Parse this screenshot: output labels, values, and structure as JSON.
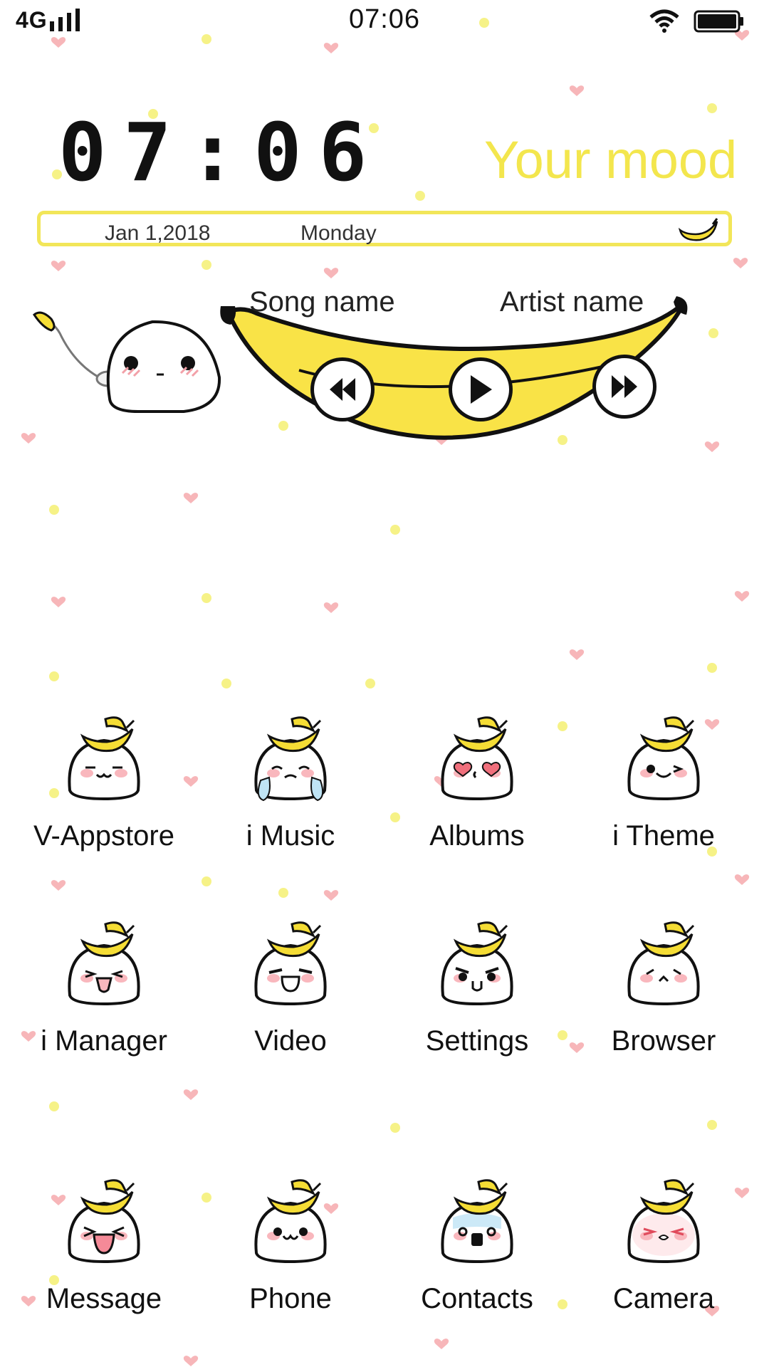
{
  "status_bar": {
    "network": "4G",
    "time": "07:06",
    "icons": [
      "signal-icon",
      "wifi-icon",
      "battery-icon"
    ]
  },
  "widget": {
    "clock": "07:06",
    "mood_text": "Your mood",
    "date": "Jan 1,2018",
    "weekday": "Monday"
  },
  "music": {
    "song_name": "Song name",
    "artist_name": "Artist name",
    "controls": [
      "previous-icon",
      "play-icon",
      "next-icon"
    ]
  },
  "apps": [
    {
      "label": "V-Appstore",
      "face": "smile"
    },
    {
      "label": "i Music",
      "face": "cry"
    },
    {
      "label": "Albums",
      "face": "love"
    },
    {
      "label": "i Theme",
      "face": "wink"
    },
    {
      "label": "i Manager",
      "face": "grin"
    },
    {
      "label": "Video",
      "face": "laugh"
    },
    {
      "label": "Settings",
      "face": "angry"
    },
    {
      "label": "Browser",
      "face": "calm"
    },
    {
      "label": "Message",
      "face": "tongue"
    },
    {
      "label": "Phone",
      "face": "happy"
    },
    {
      "label": "Contacts",
      "face": "shock"
    },
    {
      "label": "Camera",
      "face": "squint"
    }
  ],
  "colors": {
    "accent_yellow": "#f3e64d",
    "banana_yellow": "#f5dd35",
    "heart_pink": "#f7b6b9",
    "dot_yellow": "#f5f07a",
    "blush_pink": "#f9b7bd"
  }
}
